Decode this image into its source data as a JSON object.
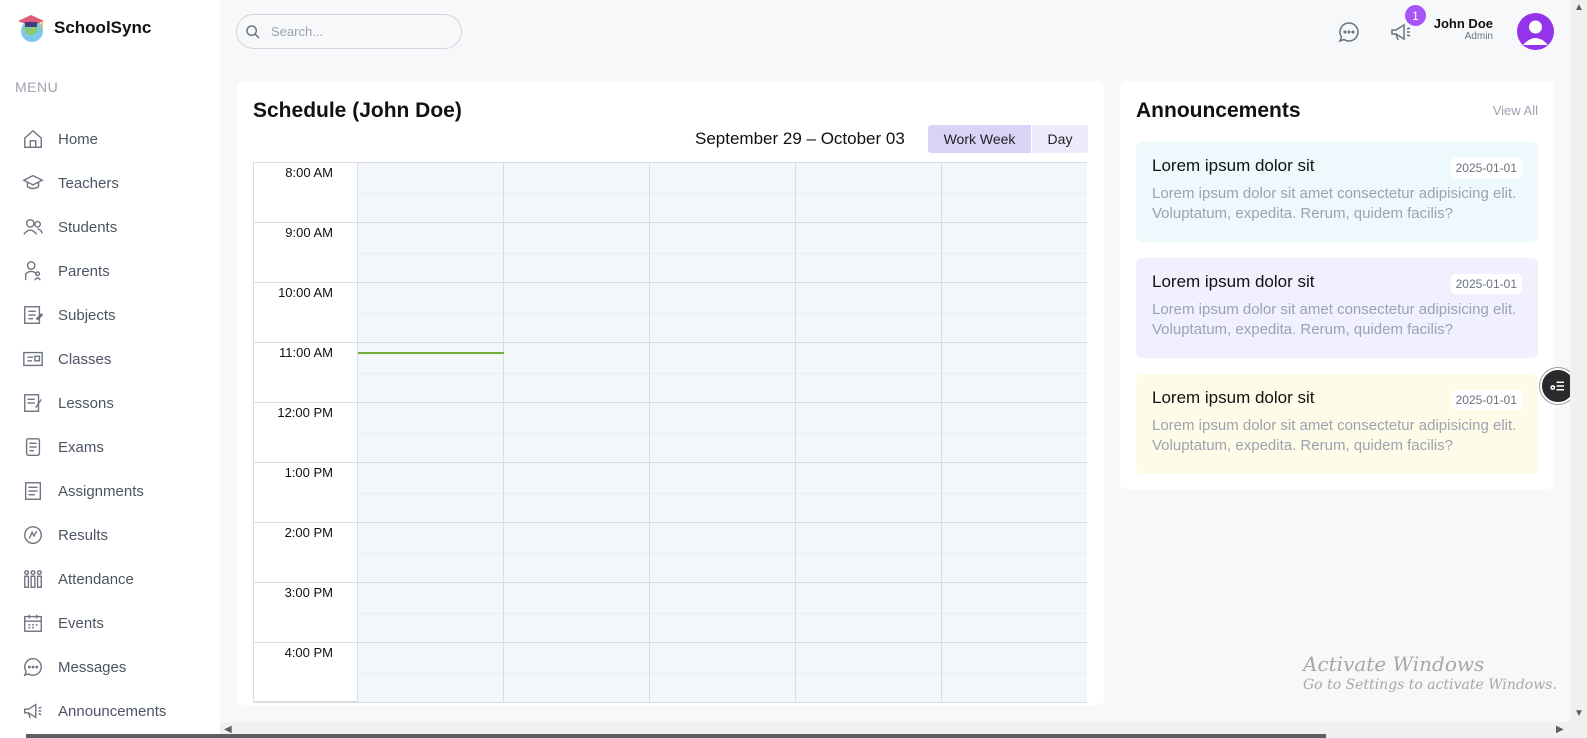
{
  "app": {
    "name": "SchoolSync"
  },
  "sidebar": {
    "menu_label": "MENU",
    "items": [
      {
        "label": "Home",
        "icon": "home-icon"
      },
      {
        "label": "Teachers",
        "icon": "teacher-icon"
      },
      {
        "label": "Students",
        "icon": "students-icon"
      },
      {
        "label": "Parents",
        "icon": "parents-icon"
      },
      {
        "label": "Subjects",
        "icon": "subjects-icon"
      },
      {
        "label": "Classes",
        "icon": "classes-icon"
      },
      {
        "label": "Lessons",
        "icon": "lessons-icon"
      },
      {
        "label": "Exams",
        "icon": "exams-icon"
      },
      {
        "label": "Assignments",
        "icon": "assignments-icon"
      },
      {
        "label": "Results",
        "icon": "results-icon"
      },
      {
        "label": "Attendance",
        "icon": "attendance-icon"
      },
      {
        "label": "Events",
        "icon": "calendar-icon"
      },
      {
        "label": "Messages",
        "icon": "message-icon"
      },
      {
        "label": "Announcements",
        "icon": "megaphone-icon"
      }
    ]
  },
  "topbar": {
    "search_placeholder": "Search...",
    "notification_count": "1",
    "user_name": "John Doe",
    "user_role": "Admin"
  },
  "schedule": {
    "title": "Schedule (John Doe)",
    "date_range": "September 29 – October 03",
    "views": {
      "work_week": "Work Week",
      "day": "Day"
    },
    "times": [
      "8:00 AM",
      "9:00 AM",
      "10:00 AM",
      "11:00 AM",
      "12:00 PM",
      "1:00 PM",
      "2:00 PM",
      "3:00 PM",
      "4:00 PM"
    ]
  },
  "announcements": {
    "title": "Announcements",
    "view_all": "View All",
    "items": [
      {
        "title": "Lorem ipsum dolor sit",
        "date": "2025-01-01",
        "desc": "Lorem ipsum dolor sit amet consectetur adipisicing elit. Voluptatum, expedita. Rerum, quidem facilis?",
        "color": "#EDF9FD"
      },
      {
        "title": "Lorem ipsum dolor sit",
        "date": "2025-01-01",
        "desc": "Lorem ipsum dolor sit amet consectetur adipisicing elit. Voluptatum, expedita. Rerum, quidem facilis?",
        "color": "#F1F0FF"
      },
      {
        "title": "Lorem ipsum dolor sit",
        "date": "2025-01-01",
        "desc": "Lorem ipsum dolor sit amet consectetur adipisicing elit. Voluptatum, expedita. Rerum, quidem facilis?",
        "color": "#FEFCE8"
      }
    ]
  },
  "watermark": {
    "line1": "Activate Windows",
    "line2": "Go to Settings to activate Windows."
  },
  "colors": {
    "accent": "#A855F7",
    "avatar": "#9333EA",
    "view_active": "#D8D4F8",
    "now_line": "#74AD3A"
  }
}
